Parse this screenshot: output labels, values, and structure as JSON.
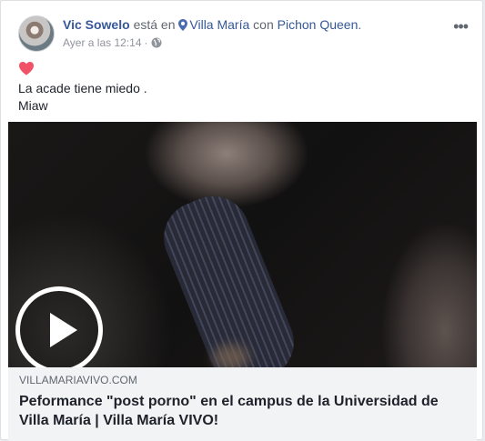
{
  "post": {
    "author": "Vic Sowelo",
    "verb": "está en",
    "place": "Villa María",
    "connector": "con",
    "tagged": "Pichon Queen",
    "period": ".",
    "timestamp": "Ayer a las 12:14",
    "separator": "·",
    "privacy_icon": "globe-icon",
    "more_label": "•••",
    "feeling_icon": "heart-icon",
    "text_lines": [
      "La acade tiene miedo .",
      "Miaw"
    ]
  },
  "link_preview": {
    "domain": "VILLAMARIAVIVO.COM",
    "title": "Peformance \"post porno\" en el campus de la Universidad de Villa María | Villa María VIVO!"
  },
  "colors": {
    "name_link": "#365899",
    "text": "#1d2129",
    "meta": "#90949c",
    "heart": "#f25268",
    "link_box_bg": "#f2f3f5"
  }
}
